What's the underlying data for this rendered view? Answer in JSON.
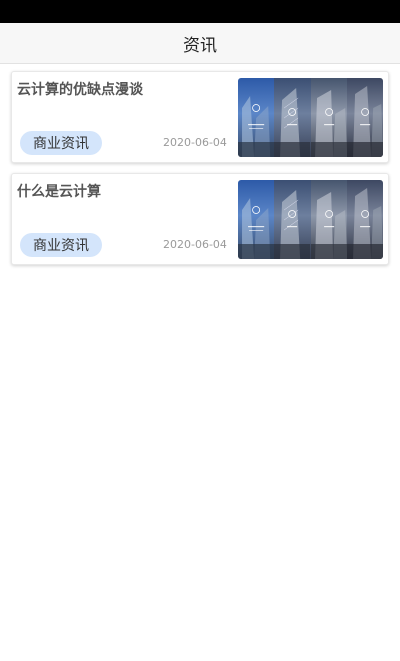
{
  "nav": {
    "title": "资讯"
  },
  "articles": [
    {
      "title": "云计算的优缺点漫谈",
      "tag": "商业资讯",
      "date": "2020-06-04",
      "thumbnail": "city-buildings-image"
    },
    {
      "title": "什么是云计算",
      "tag": "商业资讯",
      "date": "2020-06-04",
      "thumbnail": "city-buildings-image"
    }
  ],
  "colors": {
    "tag_bg": "#d4e5fb",
    "title_text": "#555555",
    "date_text": "#9a9a9a",
    "nav_bg": "#f7f7f7",
    "status_bar": "#000000"
  }
}
